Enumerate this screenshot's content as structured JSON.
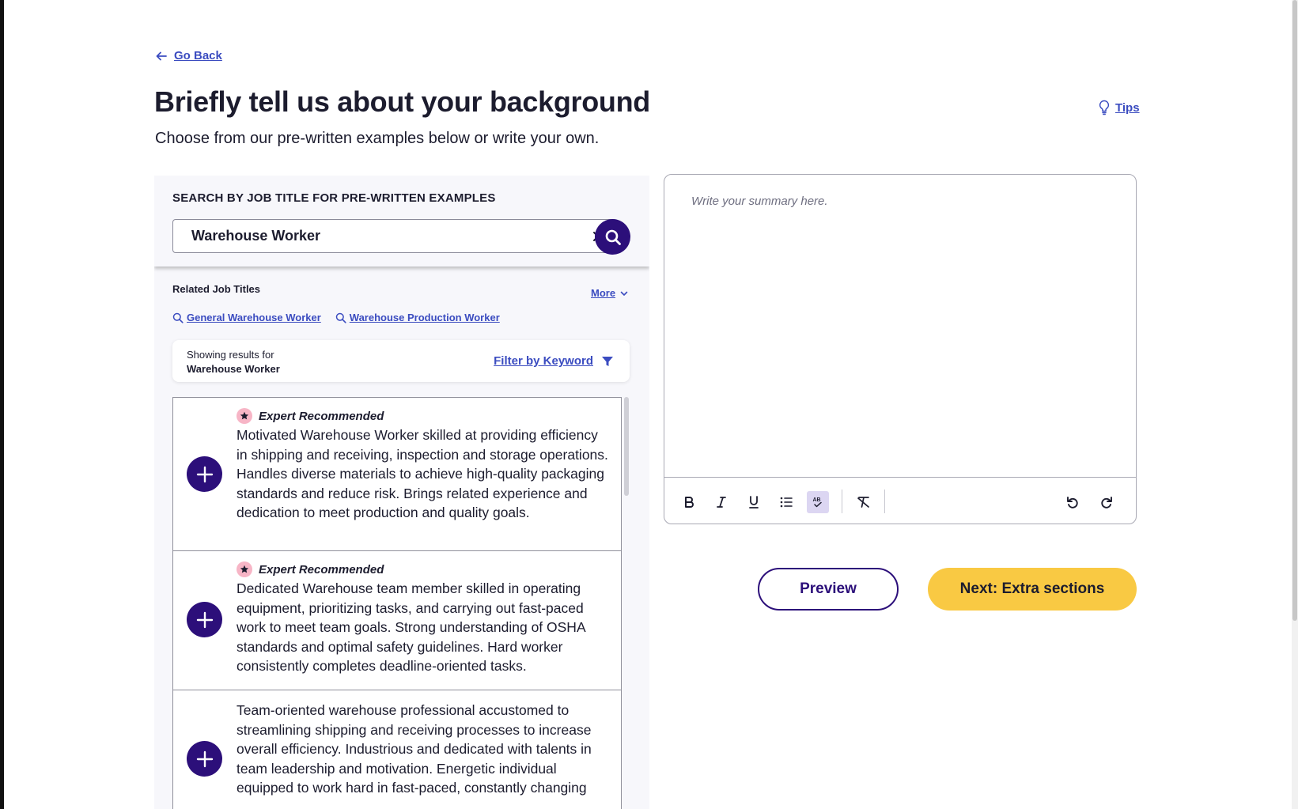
{
  "nav": {
    "go_back": "Go Back",
    "tips": "Tips"
  },
  "header": {
    "title": "Briefly tell us about your background",
    "subtitle": "Choose from our pre-written examples below or write your own."
  },
  "search": {
    "label": "SEARCH BY JOB TITLE FOR PRE-WRITTEN EXAMPLES",
    "value": "Warehouse Worker"
  },
  "related": {
    "title": "Related Job Titles",
    "more": "More",
    "links": [
      "General Warehouse Worker",
      "Warehouse Production Worker"
    ]
  },
  "results": {
    "showing_label": "Showing results for",
    "showing_value": "Warehouse Worker",
    "filter": "Filter by Keyword"
  },
  "examples": [
    {
      "badge": "Expert Recommended",
      "text": "Motivated Warehouse Worker skilled at providing efficiency in shipping and receiving, inspection and storage operations. Handles diverse materials to achieve high-quality packaging standards and reduce risk. Brings related experience and dedication to meet production and quality goals."
    },
    {
      "badge": "Expert Recommended",
      "text": "Dedicated Warehouse team member skilled in operating equipment, prioritizing tasks, and carrying out fast-paced work to meet team goals. Strong understanding of OSHA standards and optimal safety guidelines. Hard worker consistently completes deadline-oriented tasks."
    },
    {
      "badge": "",
      "text": "Team-oriented warehouse professional accustomed to streamlining shipping and receiving processes to increase overall efficiency. Industrious and dedicated with talents in team leadership and motivation. Energetic individual equipped to work hard in fast-paced, constantly changing"
    }
  ],
  "editor": {
    "placeholder": "Write your summary here.",
    "toolbar": [
      "bold-icon",
      "italic-icon",
      "underline-icon",
      "bullet-list-icon",
      "spellcheck-icon",
      "clear-format-icon",
      "undo-icon",
      "redo-icon"
    ]
  },
  "actions": {
    "preview": "Preview",
    "next": "Next: Extra sections"
  },
  "colors": {
    "primary": "#2c0f7a",
    "link": "#3b4cc0",
    "accent": "#f9c943",
    "badge": "#f7b5c6"
  }
}
